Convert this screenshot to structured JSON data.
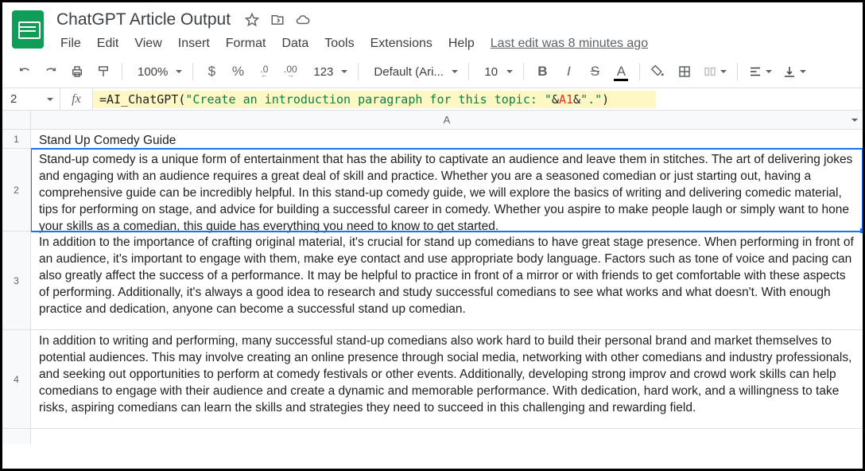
{
  "document": {
    "title": "ChatGPT Article Output",
    "last_edit": "Last edit was 8 minutes ago"
  },
  "menu": {
    "file": "File",
    "edit": "Edit",
    "view": "View",
    "insert": "Insert",
    "format": "Format",
    "data": "Data",
    "tools": "Tools",
    "extensions": "Extensions",
    "help": "Help"
  },
  "toolbar": {
    "zoom": "100%",
    "currency": "$",
    "percent": "%",
    "dec_dec": ".0",
    "dec_inc": ".00",
    "num_format": "123",
    "font": "Default (Ari...",
    "font_size": "10",
    "bold": "B",
    "italic": "I",
    "strike": "S",
    "text_color": "A"
  },
  "formula": {
    "cell_ref": "2",
    "fx_label": "fx",
    "eq": "=",
    "fn": "AI_ChatGPT",
    "open": "(",
    "str1": "\"Create an introduction paragraph for this topic: \"",
    "amp1": "&",
    "ref": "A1",
    "amp2": "&",
    "str2": "\".\"",
    "close": ")"
  },
  "sheet": {
    "col": "A",
    "rows": {
      "r1": {
        "num": "1",
        "text": "Stand Up Comedy Guide"
      },
      "r2": {
        "num": "2",
        "text": "Stand-up comedy is a unique form of entertainment that has the ability to captivate an audience and leave them in stitches. The art of delivering jokes and engaging with an audience requires a great deal of skill and practice. Whether you are a seasoned comedian or just starting out, having a comprehensive guide can be incredibly helpful. In this stand-up comedy guide, we will explore the basics of writing and delivering comedic material, tips for performing on stage, and advice for building a successful career in comedy. Whether you aspire to make people laugh or simply want to hone your skills as a comedian, this guide has everything you need to know to get started."
      },
      "r3": {
        "num": "3",
        "text": "In addition to the importance of crafting original material, it's crucial for stand up comedians to have great stage presence. When performing in front of an audience, it's important to engage with them, make eye contact and use appropriate body language. Factors such as tone of voice and pacing can also greatly affect the success of a performance. It may be helpful to practice in front of a mirror or with friends to get comfortable with these aspects of performing. Additionally, it's always a good idea to research and study successful comedians to see what works and what doesn't. With enough practice and dedication, anyone can become a successful stand up comedian."
      },
      "r4": {
        "num": "4",
        "text": "In addition to writing and performing, many successful stand-up comedians also work hard to build their personal brand and market themselves to potential audiences. This may involve creating an online presence through social media, networking with other comedians and industry professionals, and seeking out opportunities to perform at comedy festivals or other events. Additionally, developing strong improv and crowd work skills can help comedians to engage with their audience and create a dynamic and memorable performance. With dedication, hard work, and a willingness to take risks, aspiring comedians can learn the skills and strategies they need to succeed in this challenging and rewarding field."
      }
    }
  }
}
